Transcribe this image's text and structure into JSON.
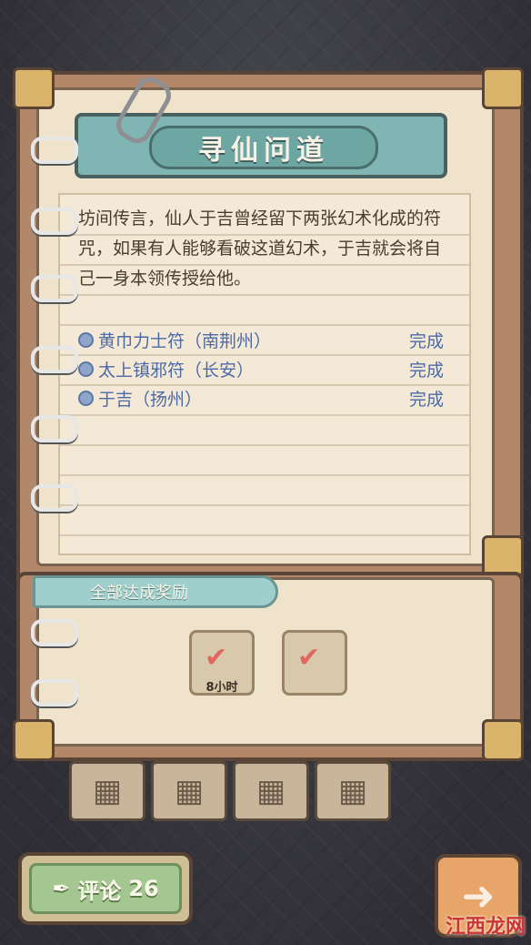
{
  "quest": {
    "title": "寻仙问道",
    "description": "坊间传言，仙人于吉曾经留下两张幻术化成的符咒，如果有人能够看破这道幻术，于吉就会将自己一身本领传授给他。",
    "tasks": [
      {
        "label": "黄巾力士符（南荆州）",
        "status": "完成"
      },
      {
        "label": "太上镇邪符（长安）",
        "status": "完成"
      },
      {
        "label": "于吉（扬州）",
        "status": "完成"
      }
    ]
  },
  "reward": {
    "banner": "全部达成奖励",
    "items": [
      {
        "icon": "heart-reward-icon",
        "amount": "8小时",
        "claimed": true
      },
      {
        "icon": "scroll-reward-icon",
        "amount": "",
        "claimed": true
      }
    ]
  },
  "bottom": {
    "comment_label": "评论",
    "comment_count": "26",
    "watermark": "江西龙网"
  },
  "colors": {
    "task_text": "#4d6aa6",
    "banner_teal": "#7fb5b2",
    "comment_green": "#a4c690",
    "next_orange": "#e8a56a",
    "check_red": "#e06660"
  }
}
